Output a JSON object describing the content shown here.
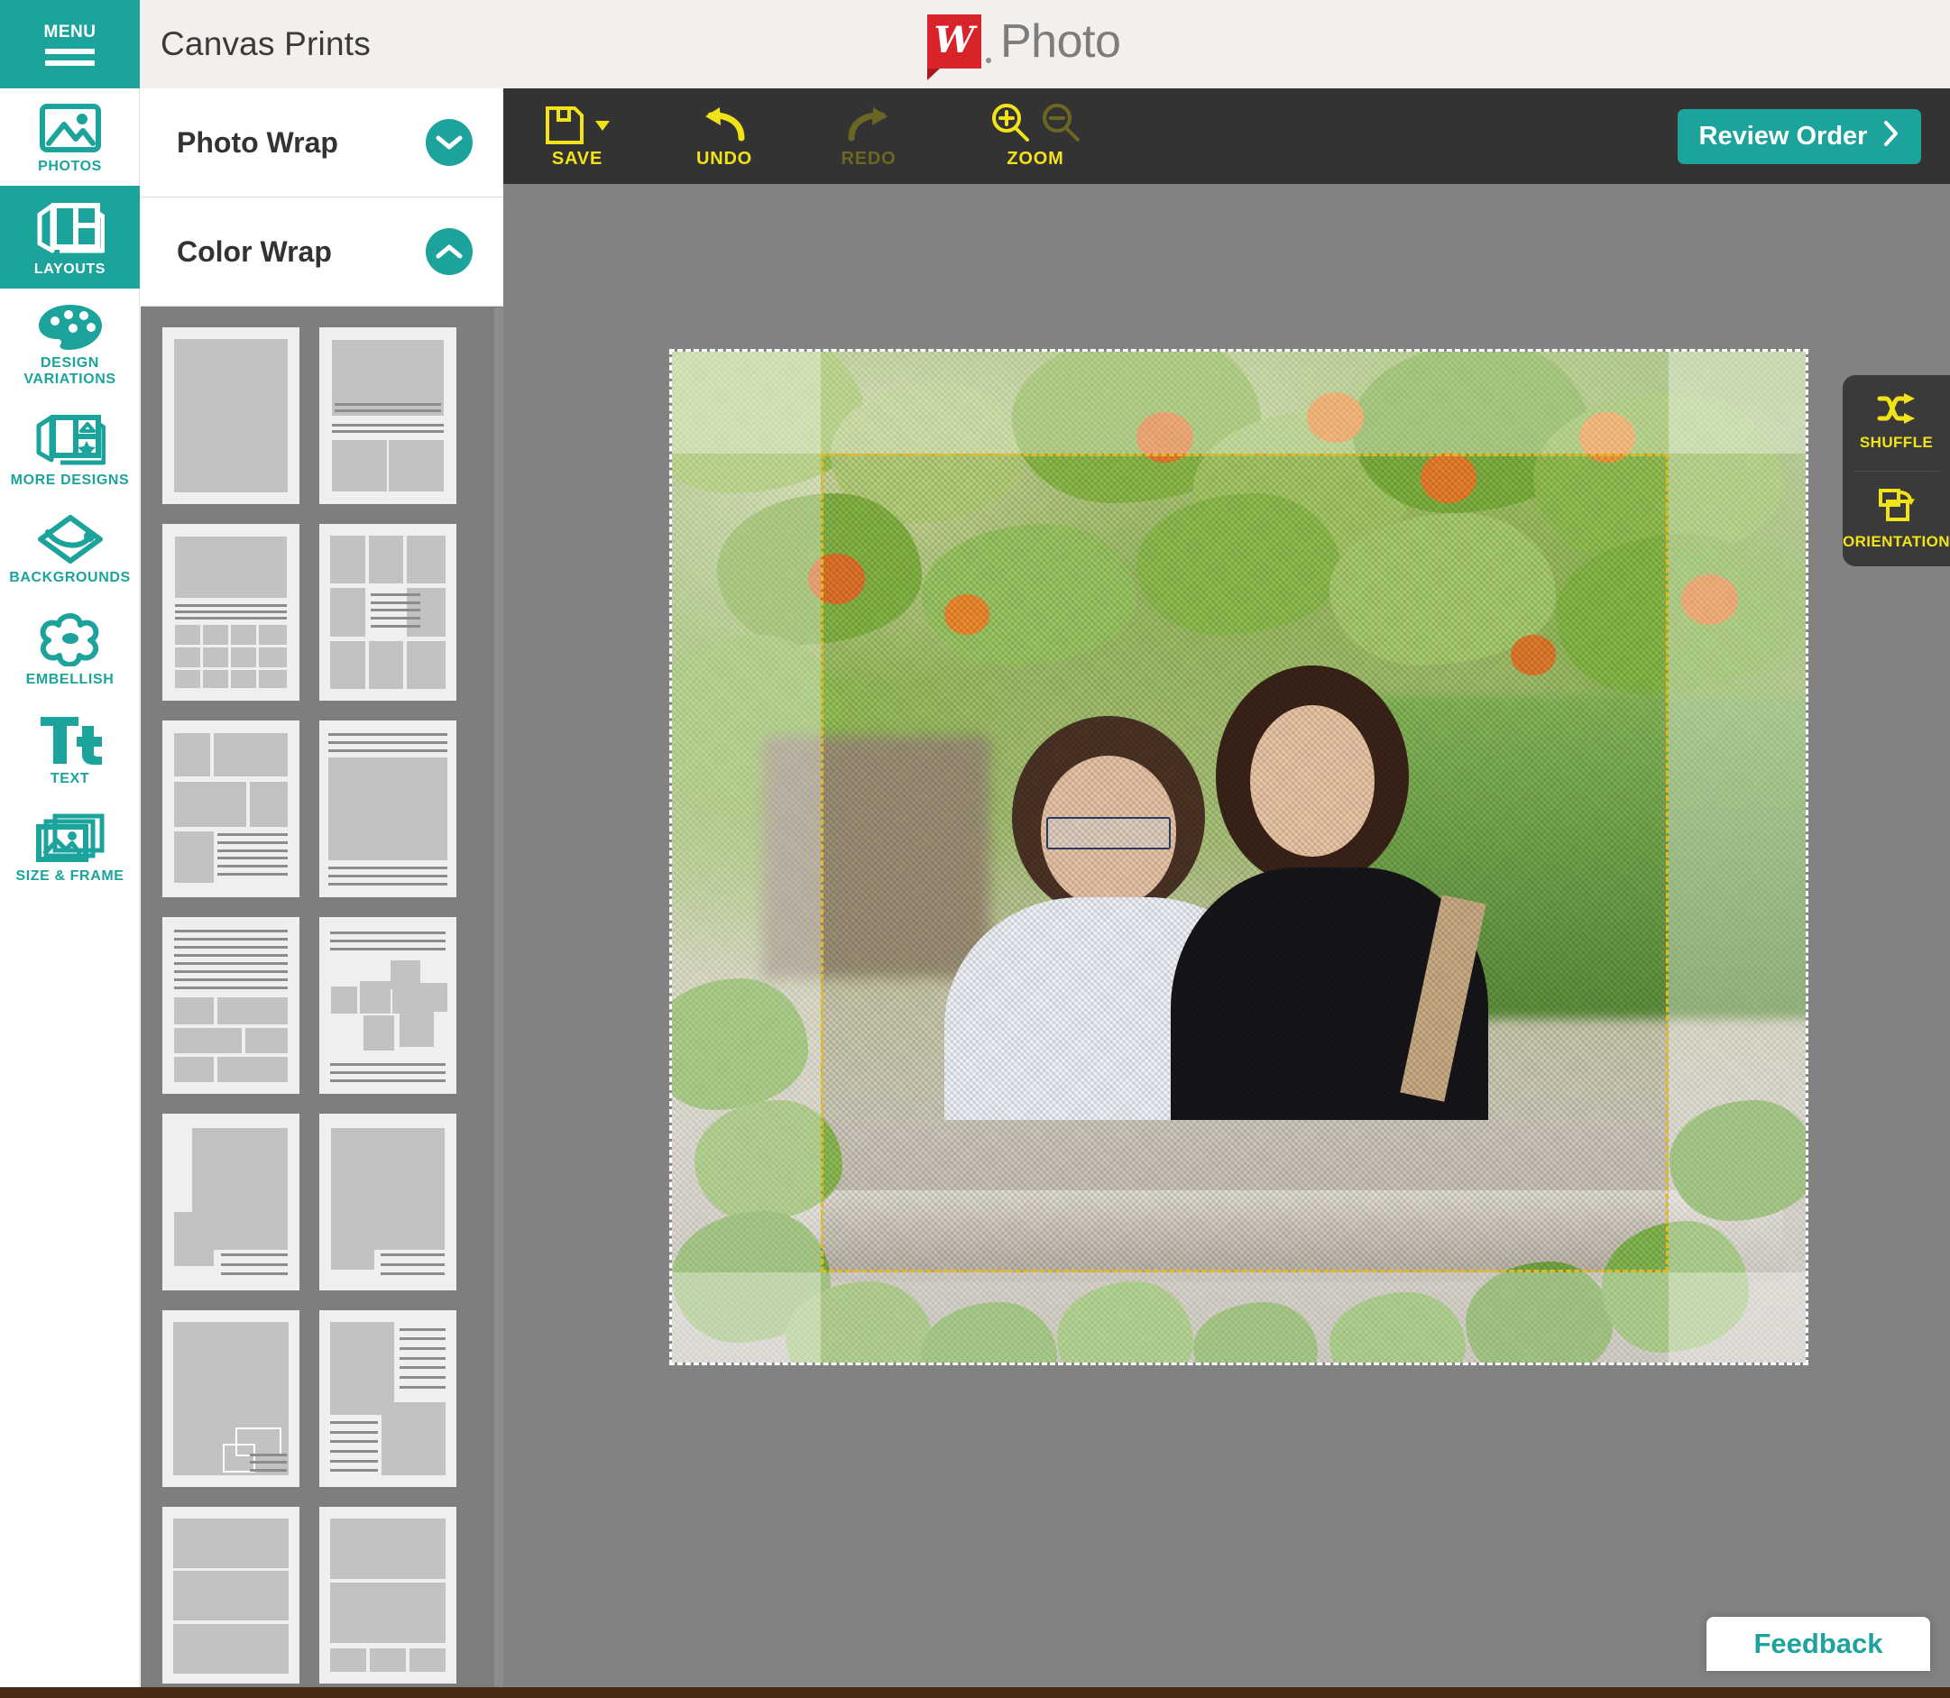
{
  "header": {
    "menu_label": "MENU",
    "product_title": "Canvas Prints",
    "brand_mark": "W",
    "brand_word": "Photo"
  },
  "sidebar": {
    "items": [
      {
        "label": "PHOTOS",
        "icon": "photo-icon",
        "active": false
      },
      {
        "label": "LAYOUTS",
        "icon": "layouts-icon",
        "active": true
      },
      {
        "label": "DESIGN VARIATIONS",
        "icon": "palette-icon",
        "active": false
      },
      {
        "label": "MORE DESIGNS",
        "icon": "more-designs-icon",
        "active": false
      },
      {
        "label": "BACKGROUNDS",
        "icon": "backgrounds-icon",
        "active": false
      },
      {
        "label": "EMBELLISH",
        "icon": "flower-icon",
        "active": false
      },
      {
        "label": "TEXT",
        "icon": "text-icon",
        "active": false
      },
      {
        "label": "SIZE & FRAME",
        "icon": "size-and-frame-icon",
        "active": false
      }
    ]
  },
  "panel": {
    "sections": [
      {
        "label": "Photo Wrap",
        "expanded": false,
        "chevron": "chevron-down-icon"
      },
      {
        "label": "Color Wrap",
        "expanded": true,
        "chevron": "chevron-up-icon"
      }
    ],
    "layout_thumbnails": [
      "single-full-photo",
      "top-photo-caption-two-below",
      "banner-photo-twelve-grid",
      "nine-grid-with-center-text",
      "collage-three-photo-text-block",
      "full-photo-top-bottom-rules",
      "text-block-six-photo-mosaic",
      "scattered-photo-collage",
      "large-photo-small-overlap-caption",
      "large-photo-inset-square-caption",
      "full-bleed-photo-small-insets",
      "two-photo-two-text-columns",
      "three-stacked-bands",
      "two-bands-with-triple-strip"
    ]
  },
  "toolbar": {
    "save_label": "SAVE",
    "save_icon": "floppy-disk-icon",
    "save_caret_icon": "caret-down-icon",
    "undo_label": "UNDO",
    "undo_icon": "undo-arrow-icon",
    "undo_enabled": true,
    "redo_label": "REDO",
    "redo_icon": "redo-arrow-icon",
    "redo_enabled": false,
    "zoom_label": "ZOOM",
    "zoom_in_icon": "magnifier-plus-icon",
    "zoom_out_icon": "magnifier-minus-icon",
    "zoom_out_enabled": false,
    "review_order_label": "Review Order",
    "review_order_icon": "chevron-right-icon"
  },
  "dock": {
    "items": [
      {
        "label": "SHUFFLE",
        "icon": "shuffle-icon"
      },
      {
        "label": "ORIENTATION",
        "icon": "orientation-icon"
      }
    ]
  },
  "canvas": {
    "bleed_guide": "white-dashed-bleed-outline",
    "safe_guide": "yellow-dashed-safe-area",
    "photo_description": "Two smiling women behind a stone ledge framed by green leaves and orange flowers"
  },
  "feedback": {
    "label": "Feedback"
  },
  "colors": {
    "brand_teal": "#1ba39c",
    "brand_red": "#d8232a",
    "toolbar_dark": "#333333",
    "tool_yellow": "#f2e318",
    "tool_yellow_disabled": "#6b6722",
    "stage_gray": "#828282",
    "panel_gray": "#7e7e7e",
    "header_cream": "#f2efec",
    "safe_guide_yellow": "#e3b92c"
  }
}
